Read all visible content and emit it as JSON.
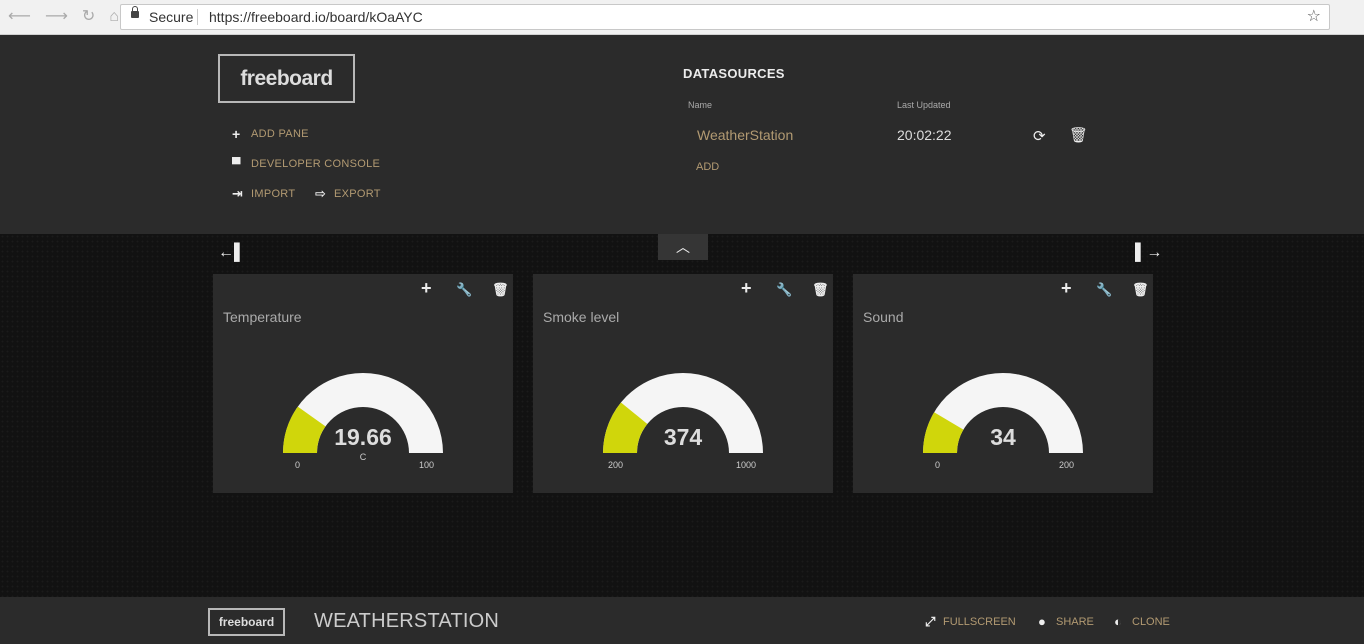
{
  "browser": {
    "secure_label": "Secure",
    "url": "https://freeboard.io/board/kOaAYC"
  },
  "admin": {
    "logo": "freeboard",
    "menu": {
      "add_pane": "ADD PANE",
      "developer_console": "DEVELOPER CONSOLE",
      "import": "IMPORT",
      "export": "EXPORT"
    },
    "datasources": {
      "title": "DATASOURCES",
      "col_name": "Name",
      "col_last_updated": "Last Updated",
      "rows": [
        {
          "name": "WeatherStation",
          "last_updated": "20:02:22"
        }
      ],
      "add_label": "ADD"
    }
  },
  "panes": [
    {
      "title": "Temperature",
      "value": "19.66",
      "unit": "C",
      "min": "0",
      "max": "100",
      "fraction": 0.1966,
      "color": "#d0d60b"
    },
    {
      "title": "Smoke level",
      "value": "374",
      "unit": "",
      "min": "200",
      "max": "1000",
      "fraction": 0.2175,
      "color": "#d0d60b"
    },
    {
      "title": "Sound",
      "value": "34",
      "unit": "",
      "min": "0",
      "max": "200",
      "fraction": 0.17,
      "color": "#d0d60b"
    }
  ],
  "footer": {
    "logo": "freeboard",
    "board_title": "WEATHERSTATION",
    "fullscreen": "FULLSCREEN",
    "share": "SHARE",
    "clone": "CLONE"
  },
  "colors": {
    "accent": "#b29a72",
    "gauge_fill": "#d0d60b",
    "gauge_bg": "#f5f5f5",
    "pane_bg": "#2b2b2b"
  }
}
